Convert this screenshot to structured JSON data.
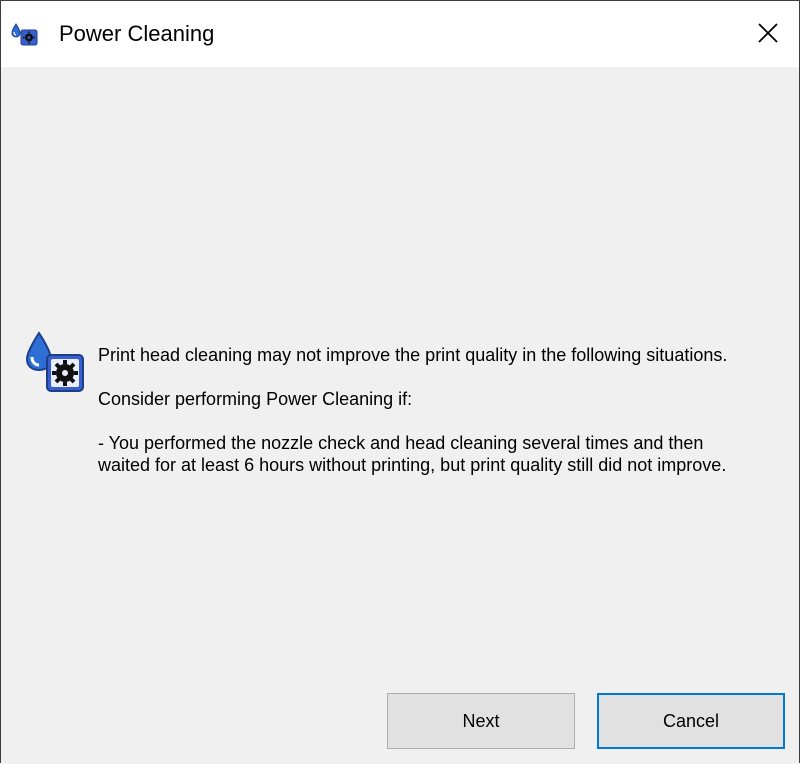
{
  "window": {
    "title": "Power Cleaning",
    "title_icon": "printer-maintenance-icon",
    "close_icon": "close-icon"
  },
  "message": {
    "icon": "printer-maintenance-icon",
    "paragraph1": "Print head cleaning may not improve the print quality in the following situations.",
    "paragraph2": "Consider performing Power Cleaning if:",
    "paragraph3": "- You performed the nozzle check and head cleaning several times and then waited for at least 6 hours without printing, but print quality still did not improve."
  },
  "buttons": {
    "next_label": "Next",
    "cancel_label": "Cancel"
  },
  "colors": {
    "titlebar_bg": "#ffffff",
    "content_bg": "#f0f0f0",
    "button_bg": "#e1e1e1",
    "focus_border": "#0078d7",
    "icon_blue": "#3a5fcd"
  }
}
